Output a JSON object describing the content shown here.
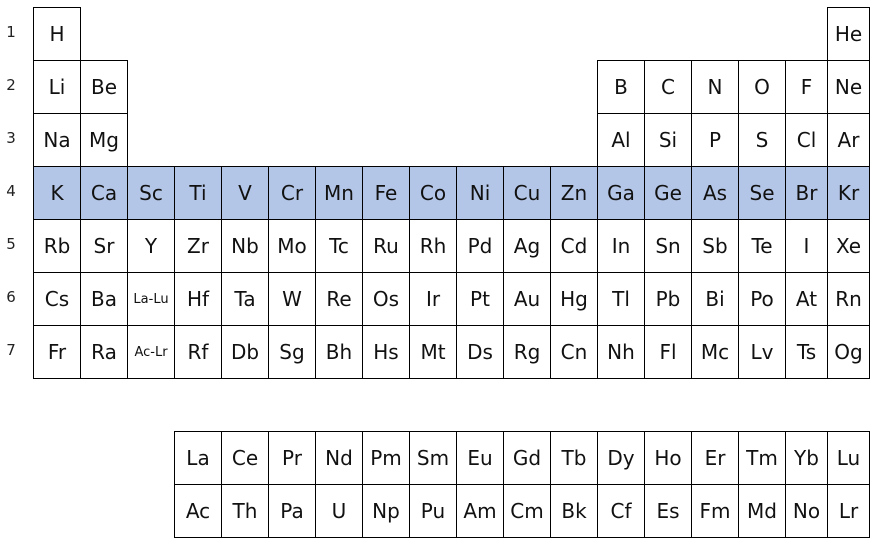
{
  "highlight_color": "#b4c6e7",
  "highlighted_period": 4,
  "periods": [
    "1",
    "2",
    "3",
    "4",
    "5",
    "6",
    "7"
  ],
  "table": [
    [
      "H",
      "",
      "",
      "",
      "",
      "",
      "",
      "",
      "",
      "",
      "",
      "",
      "",
      "",
      "",
      "",
      "",
      "He"
    ],
    [
      "Li",
      "Be",
      "",
      "",
      "",
      "",
      "",
      "",
      "",
      "",
      "",
      "",
      "B",
      "C",
      "N",
      "O",
      "F",
      "Ne"
    ],
    [
      "Na",
      "Mg",
      "",
      "",
      "",
      "",
      "",
      "",
      "",
      "",
      "",
      "",
      "Al",
      "Si",
      "P",
      "S",
      "Cl",
      "Ar"
    ],
    [
      "K",
      "Ca",
      "Sc",
      "Ti",
      "V",
      "Cr",
      "Mn",
      "Fe",
      "Co",
      "Ni",
      "Cu",
      "Zn",
      "Ga",
      "Ge",
      "As",
      "Se",
      "Br",
      "Kr"
    ],
    [
      "Rb",
      "Sr",
      "Y",
      "Zr",
      "Nb",
      "Mo",
      "Tc",
      "Ru",
      "Rh",
      "Pd",
      "Ag",
      "Cd",
      "In",
      "Sn",
      "Sb",
      "Te",
      "I",
      "Xe"
    ],
    [
      "Cs",
      "Ba",
      "La-Lu",
      "Hf",
      "Ta",
      "W",
      "Re",
      "Os",
      "Ir",
      "Pt",
      "Au",
      "Hg",
      "Tl",
      "Pb",
      "Bi",
      "Po",
      "At",
      "Rn"
    ],
    [
      "Fr",
      "Ra",
      "Ac-Lr",
      "Rf",
      "Db",
      "Sg",
      "Bh",
      "Hs",
      "Mt",
      "Ds",
      "Rg",
      "Cn",
      "Nh",
      "Fl",
      "Mc",
      "Lv",
      "Ts",
      "Og"
    ]
  ],
  "f_block": [
    [
      "La",
      "Ce",
      "Pr",
      "Nd",
      "Pm",
      "Sm",
      "Eu",
      "Gd",
      "Tb",
      "Dy",
      "Ho",
      "Er",
      "Tm",
      "Yb",
      "Lu"
    ],
    [
      "Ac",
      "Th",
      "Pa",
      "U",
      "Np",
      "Pu",
      "Am",
      "Cm",
      "Bk",
      "Cf",
      "Es",
      "Fm",
      "Md",
      "No",
      "Lr"
    ]
  ]
}
